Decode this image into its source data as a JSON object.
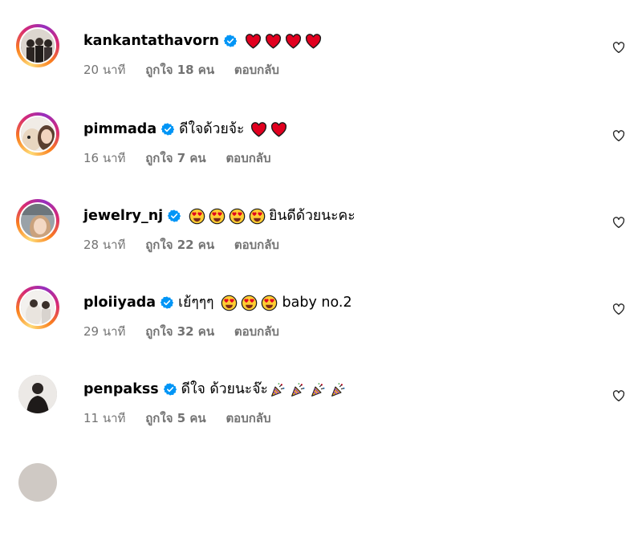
{
  "accent_color": "#0095f6",
  "heart_color": "#e1001f",
  "comments": [
    {
      "username": "kankantathavorn",
      "text": "",
      "time": "20 นาที",
      "likes": "ถูกใจ 18 คน",
      "reply_label": "ตอบกลับ",
      "emojis": [
        "red-heart",
        "red-heart",
        "red-heart",
        "red-heart"
      ],
      "emoji_after": "",
      "text_after": ""
    },
    {
      "username": "pimmada",
      "text": "ดีใจด้วยจ้ะ",
      "time": "16 นาที",
      "likes": "ถูกใจ 7 คน",
      "reply_label": "ตอบกลับ",
      "emojis": [
        "red-heart",
        "red-heart"
      ],
      "text_after": ""
    },
    {
      "username": "jewelry_nj",
      "text": "",
      "time": "28 นาที",
      "likes": "ถูกใจ 22 คน",
      "reply_label": "ตอบกลับ",
      "emojis": [
        "heart-eyes",
        "heart-eyes",
        "heart-eyes",
        "heart-eyes"
      ],
      "text_after": "ยินดีด้วยนะคะ"
    },
    {
      "username": "ploiiyada",
      "text": "เย้ๆๆๆ",
      "time": "29 นาที",
      "likes": "ถูกใจ 32 คน",
      "reply_label": "ตอบกลับ",
      "emojis": [
        "heart-eyes",
        "heart-eyes",
        "heart-eyes"
      ],
      "text_after": "baby no.2"
    },
    {
      "username": "penpakss",
      "text": "ดีใจ ด้วยนะจ๊ะ",
      "time": "11 นาที",
      "likes": "ถูกใจ 5 คน",
      "reply_label": "ตอบกลับ",
      "emojis": [
        "party-popper",
        "party-popper",
        "party-popper",
        "party-popper"
      ],
      "text_after": ""
    }
  ]
}
